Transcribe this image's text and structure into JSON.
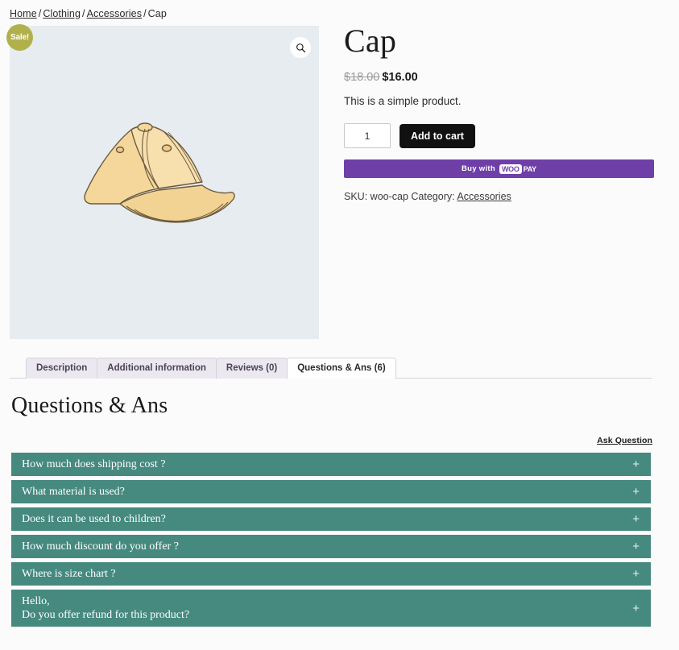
{
  "breadcrumb": {
    "items": [
      {
        "label": "Home",
        "link": true
      },
      {
        "label": "Clothing",
        "link": true
      },
      {
        "label": "Accessories",
        "link": true
      },
      {
        "label": "Cap",
        "link": false
      }
    ],
    "separator": "/"
  },
  "gallery": {
    "sale_badge": "Sale!",
    "zoom_icon": "magnifier-icon",
    "image_alt": "cap-illustration",
    "background_color": "#e6ecf0"
  },
  "product": {
    "title": "Cap",
    "price_old": "$18.00",
    "price_new": "$16.00",
    "short_description": "This is a simple product.",
    "quantity": "1",
    "quantity_placeholder": "1",
    "add_to_cart_label": "Add to cart",
    "woopay": {
      "buy_with": "Buy with",
      "woo": "WOO",
      "pay": "PAY",
      "color": "#6f3fa8"
    },
    "meta": {
      "sku_label": "SKU:",
      "sku_value": "woo-cap",
      "category_label": "Category:",
      "category_value": "Accessories"
    }
  },
  "tabs": [
    {
      "label": "Description",
      "active": false
    },
    {
      "label": "Additional information",
      "active": false
    },
    {
      "label": "Reviews (0)",
      "active": false
    },
    {
      "label": "Questions & Ans (6)",
      "active": true
    }
  ],
  "qa": {
    "heading": "Questions & Ans",
    "ask_question_label": "Ask Question",
    "expand_icon": "+",
    "accent_color": "#45897f",
    "items": [
      {
        "question": "How much does shipping cost ?",
        "multiline": false
      },
      {
        "question": "What material is used?",
        "multiline": false
      },
      {
        "question": "Does it can be used to children?",
        "multiline": false
      },
      {
        "question": "How much discount do you offer ?",
        "multiline": false
      },
      {
        "question": "Where is size chart ?",
        "multiline": false
      },
      {
        "question": "Hello,\nDo you offer refund for this product?",
        "multiline": true
      }
    ]
  }
}
